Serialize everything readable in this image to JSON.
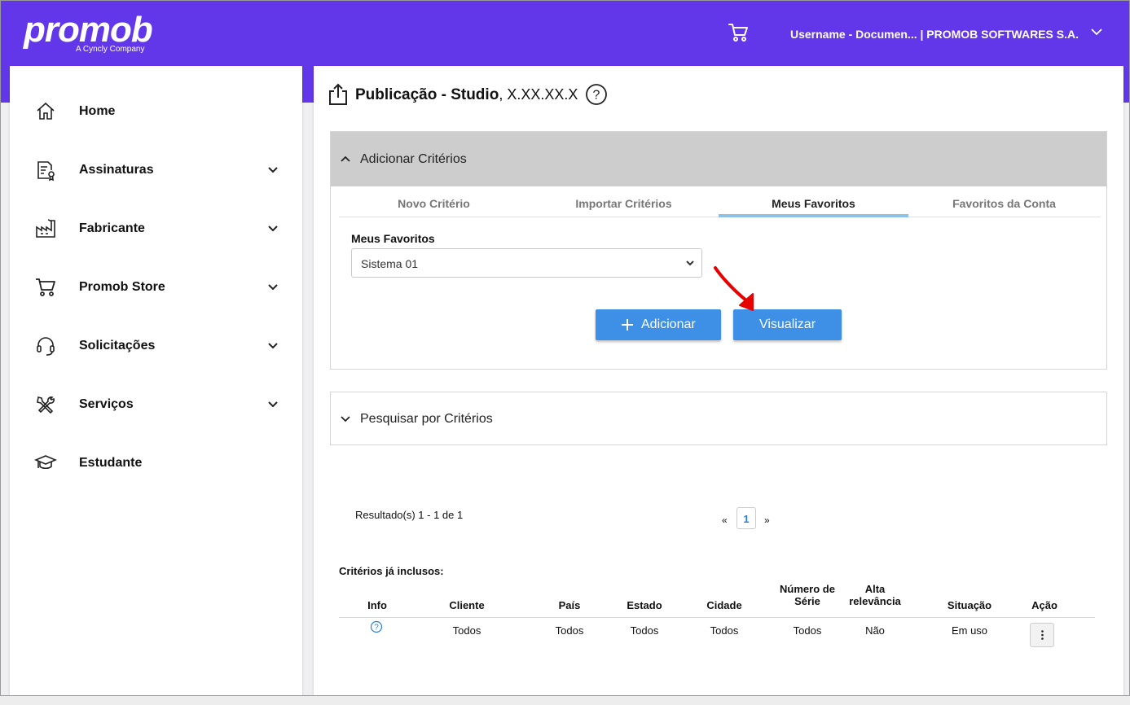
{
  "header": {
    "logo": "promob",
    "logo_sub": "A Cyncly Company",
    "user": "Username - Documen... | PROMOB SOFTWARES S.A."
  },
  "sidebar": {
    "items": [
      {
        "label": "Home",
        "icon": "home-icon"
      },
      {
        "label": "Assinaturas",
        "icon": "document-badge-icon"
      },
      {
        "label": "Fabricante",
        "icon": "factory-icon"
      },
      {
        "label": "Promob Store",
        "icon": "cart-icon"
      },
      {
        "label": "Solicitações",
        "icon": "headset-icon"
      },
      {
        "label": "Serviços",
        "icon": "tools-icon"
      },
      {
        "label": "Estudante",
        "icon": "graduation-cap-icon"
      }
    ]
  },
  "page": {
    "title": "Publicação - Studio",
    "version": ", X.XX.XX.X"
  },
  "criteria_panel": {
    "title": "Adicionar Critérios",
    "tabs": [
      "Novo Critério",
      "Importar Critérios",
      "Meus Favoritos",
      "Favoritos da Conta"
    ],
    "active_tab": "Meus Favoritos",
    "favorites_label": "Meus Favoritos",
    "favorites_selected": "Sistema 01",
    "add_button": "Adicionar",
    "view_button": "Visualizar"
  },
  "search_panel": {
    "title": "Pesquisar por Critérios"
  },
  "results": {
    "summary": "Resultado(s) 1 - 1 de 1",
    "prev": "«",
    "page": "1",
    "next": "»"
  },
  "table": {
    "caption": "Critérios já inclusos:",
    "headers": [
      "Info",
      "Cliente",
      "País",
      "Estado",
      "Cidade",
      "Número de Série",
      "Alta relevância",
      "Situação",
      "Ação"
    ],
    "rows": [
      {
        "cliente": "Todos",
        "pais": "Todos",
        "estado": "Todos",
        "cidade": "Todos",
        "numero_serie": "Todos",
        "alta_relevancia": "Não",
        "situacao": "Em uso"
      }
    ]
  },
  "colors": {
    "brand": "#6236e9",
    "button": "#3d90e6",
    "tab_active": "#8bc2e6",
    "annotation_arrow": "#e60000"
  }
}
